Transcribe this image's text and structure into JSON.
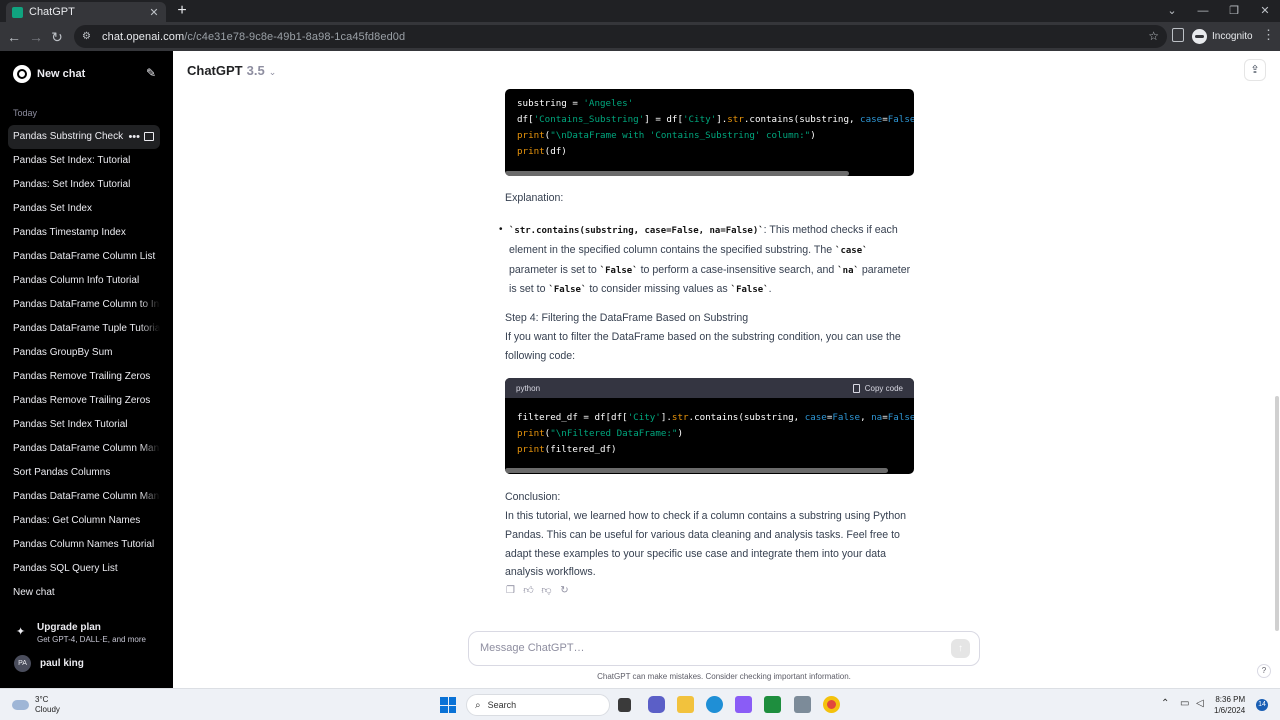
{
  "browser": {
    "tab_title": "ChatGPT",
    "url_host": "chat.openai.com",
    "url_path": "/c/c4e31e78-9c8e-49b1-8a98-1ca45fd8ed0d",
    "profile": "Incognito"
  },
  "sidebar": {
    "new_chat": "New chat",
    "section_label": "Today",
    "items": [
      "Pandas Substring Check",
      "Pandas Set Index: Tutorial",
      "Pandas: Set Index Tutorial",
      "Pandas Set Index",
      "Pandas Timestamp Index",
      "Pandas DataFrame Column List",
      "Pandas Column Info Tutorial",
      "Pandas DataFrame Column to Ind",
      "Pandas DataFrame Tuple Tutorial",
      "Pandas GroupBy Sum",
      "Pandas Remove Trailing Zeros",
      "Pandas Remove Trailing Zeros",
      "Pandas Set Index Tutorial",
      "Pandas DataFrame Column Mana",
      "Sort Pandas Columns",
      "Pandas DataFrame Column Mana",
      "Pandas: Get Column Names",
      "Pandas Column Names Tutorial",
      "Pandas SQL Query List",
      "New chat"
    ],
    "upgrade_title": "Upgrade plan",
    "upgrade_sub": "Get GPT-4, DALL·E, and more",
    "user_initials": "PA",
    "user_name": "paul king"
  },
  "header": {
    "model_name": "ChatGPT",
    "model_version": "3.5"
  },
  "content": {
    "code1_lines": [
      "substring = 'Angeles'",
      "df['Contains_Substring'] = df['City'].str.contains(substring, case=False",
      "print(\"\\nDataFrame with 'Contains_Substring' column:\")",
      "print(df)"
    ],
    "explanation_heading": "Explanation:",
    "bullet_code": "`str.contains(substring, case=False, na=False)`",
    "bullet_text_1": ": This method checks if each element in the specified column contains the specified substring. The ",
    "bullet_code_case": "`case`",
    "bullet_text_2": " parameter is set to ",
    "bullet_code_false1": "`False`",
    "bullet_text_3": " to perform a case-insensitive search, and ",
    "bullet_code_na": "`na`",
    "bullet_text_4": " parameter is set to ",
    "bullet_code_false2": "`False`",
    "bullet_text_5": " to consider missing values as ",
    "bullet_code_false3": "`False`",
    "bullet_text_6": ".",
    "step4_heading": "Step 4: Filtering the DataFrame Based on Substring",
    "step4_text": "If you want to filter the DataFrame based on the substring condition, you can use the following code:",
    "code2_lang": "python",
    "code2_copy": "Copy code",
    "code2_lines": [
      "filtered_df = df[df['City'].str.contains(substring, case=False, na=False",
      "print(\"\\nFiltered DataFrame:\")",
      "print(filtered_df)"
    ],
    "conclusion_heading": "Conclusion:",
    "conclusion_text": "In this tutorial, we learned how to check if a column contains a substring using Python Pandas. This can be useful for various data cleaning and analysis tasks. Feel free to adapt these examples to your specific use case and integrate them into your data analysis workflows."
  },
  "composer": {
    "placeholder": "Message ChatGPT…",
    "disclaimer": "ChatGPT can make mistakes. Consider checking important information."
  },
  "taskbar": {
    "temp": "3°C",
    "weather": "Cloudy",
    "search": "Search",
    "time": "8:36 PM",
    "date": "1/6/2024",
    "notifications": "14"
  },
  "colors": {
    "sidebar_bg": "#000000",
    "code_bg": "#000000",
    "code_string": "#00a67d",
    "code_keyword": "#2e95d3",
    "code_function": "#e9950c"
  }
}
